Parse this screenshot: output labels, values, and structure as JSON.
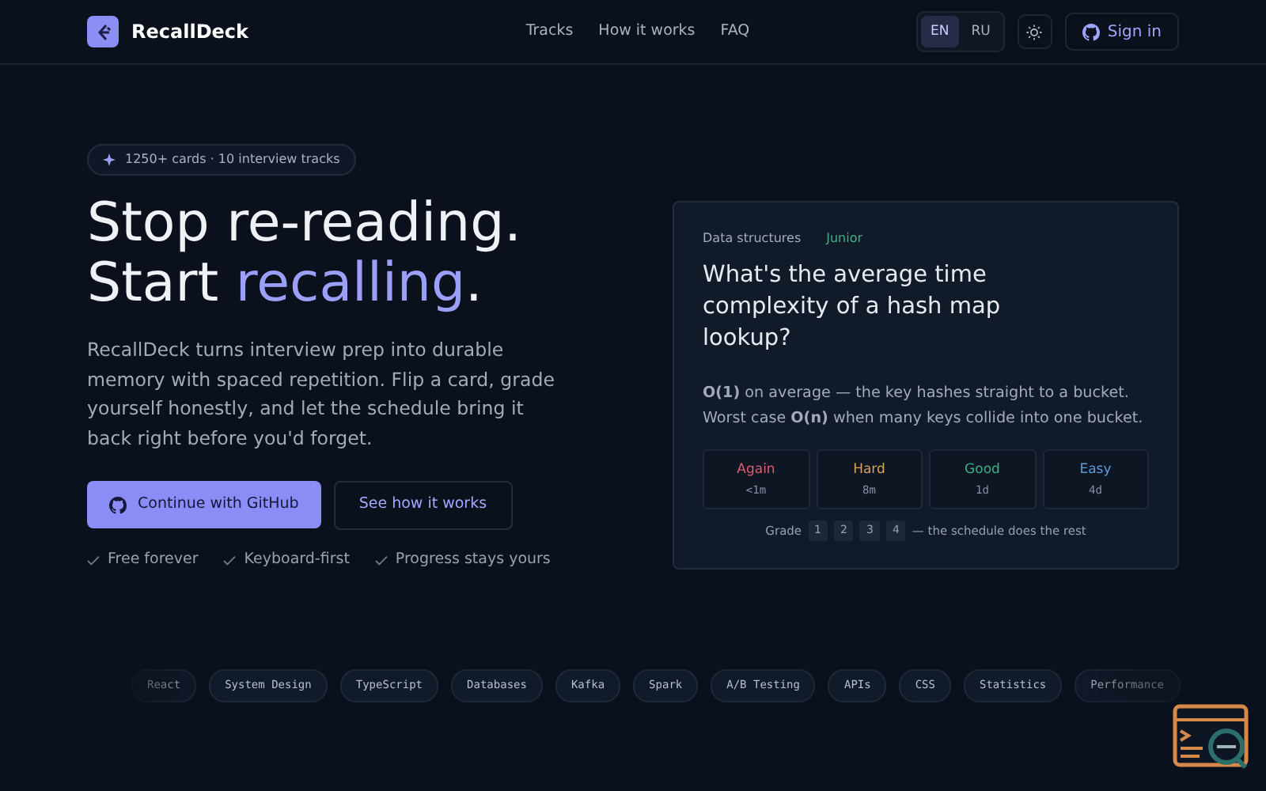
{
  "brand": {
    "name": "RecallDeck"
  },
  "nav": [
    "Tracks",
    "How it works",
    "FAQ"
  ],
  "languages": [
    {
      "label": "EN",
      "selected": true
    },
    {
      "label": "RU",
      "selected": false
    }
  ],
  "sign_in": "Sign in",
  "hero": {
    "badge": "1250+ cards · 10 interview tracks",
    "title_line1": "Stop re-reading.",
    "title_line2_start": "Start ",
    "title_line2_accent": "recalling",
    "title_line2_end": ".",
    "lead": "RecallDeck turns interview prep into durable memory with spaced repetition. Flip a card, grade yourself honestly, and let the schedule bring it back right before you'd forget.",
    "primary_button": "Continue with GitHub",
    "secondary_button": "See how it works",
    "perks": [
      "Free forever",
      "Keyboard-first",
      "Progress stays yours"
    ]
  },
  "card": {
    "category": "Data structures",
    "level": "Junior",
    "question": "What's the average time complexity of a hash map lookup?",
    "answer": "**O(1)** on average — the key hashes straight to a bucket. Worst case **O(n)** when many keys collide into one bucket.",
    "grades": [
      {
        "label": "Again",
        "interval": "<1m",
        "color": "#e05d6f"
      },
      {
        "label": "Hard",
        "interval": "8m",
        "color": "#d9a55b"
      },
      {
        "label": "Good",
        "interval": "1d",
        "color": "#3fae86"
      },
      {
        "label": "Easy",
        "interval": "4d",
        "color": "#5b9be0"
      }
    ],
    "hint_start": "Grade",
    "keys": [
      "1",
      "2",
      "3",
      "4"
    ],
    "hint_end": "— the schedule does the rest"
  },
  "tracks": [
    "React",
    "System Design",
    "TypeScript",
    "Databases",
    "Kafka",
    "Spark",
    "A/B Testing",
    "APIs",
    "CSS",
    "Statistics",
    "Performance"
  ]
}
